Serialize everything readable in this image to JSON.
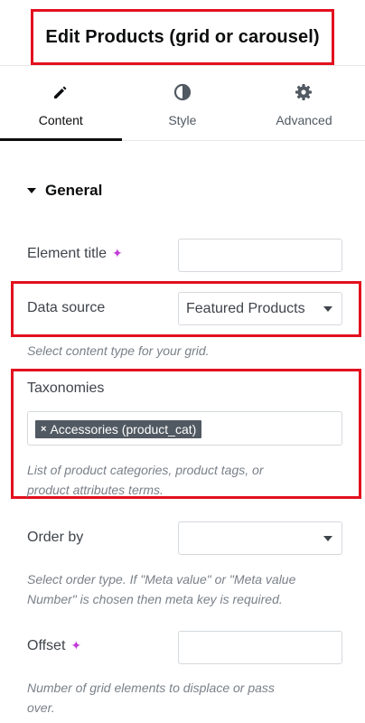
{
  "header": {
    "title": "Edit Products (grid or carousel)"
  },
  "tabs": [
    {
      "label": "Content",
      "icon": "pencil-icon"
    },
    {
      "label": "Style",
      "icon": "contrast-icon"
    },
    {
      "label": "Advanced",
      "icon": "gear-icon"
    }
  ],
  "section": {
    "title": "General"
  },
  "fields": {
    "element_title": {
      "label": "Element title",
      "value": ""
    },
    "data_source": {
      "label": "Data source",
      "selected": "Featured Products",
      "help": "Select content type for your grid."
    },
    "taxonomies": {
      "label": "Taxonomies",
      "tags": [
        "Accessories (product_cat)"
      ],
      "help_line1": "List of product categories, product tags, or",
      "help_line2": "product attributes terms."
    },
    "order_by": {
      "label": "Order by",
      "selected": "",
      "help_line1": "Select order type. If \"Meta value\" or \"Meta value",
      "help_line2": "Number\" is chosen then meta key is required."
    },
    "offset": {
      "label": "Offset",
      "value": "",
      "help_line1": "Number of grid elements to displace or pass",
      "help_line2": "over."
    }
  },
  "colors": {
    "highlight": "#e3101e",
    "ai_spark": "#c13bd8",
    "tag_bg": "#515962"
  }
}
